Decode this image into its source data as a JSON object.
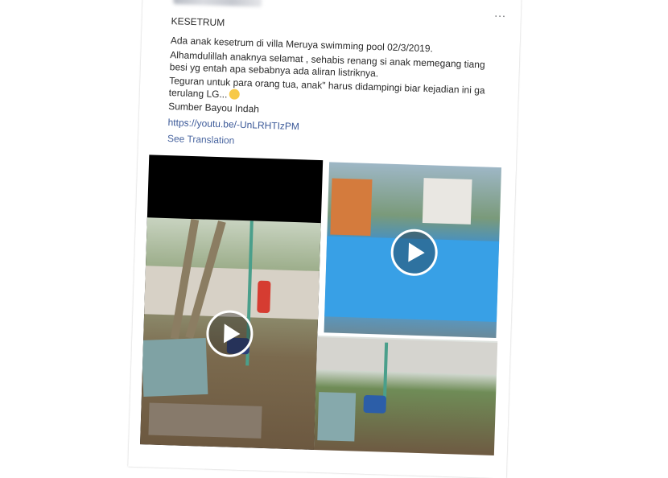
{
  "post": {
    "more_label": "...",
    "title": "KESETRUM",
    "line1": "Ada anak kesetrum di villa Meruya swimming pool 02/3/2019.",
    "para2": "Alhamdulillah anaknya selamat , sehabis renang si anak memegang tiang besi yg entah apa sebabnya ada aliran listriknya.",
    "para3": "Teguran untuk para orang tua, anak\" harus didampingi biar kejadian ini ga terulang LG...",
    "source": "Sumber Bayou Indah",
    "link": "https://youtu.be/-UnLRHTIzPM",
    "see_translation": "See Translation"
  },
  "media": {
    "videos": [
      {
        "name": "video-electrocution-scene",
        "play_icon": "play-icon"
      },
      {
        "name": "video-swimming-pool",
        "play_icon": "play-icon"
      },
      {
        "name": "video-kid-on-ground",
        "play_icon": "none"
      }
    ]
  },
  "colors": {
    "link": "#3b5998",
    "pool": "#38a0e6",
    "shirt": "#d63c31"
  },
  "icons": [
    "more-options-icon",
    "smile-emoji-icon",
    "play-icon"
  ]
}
